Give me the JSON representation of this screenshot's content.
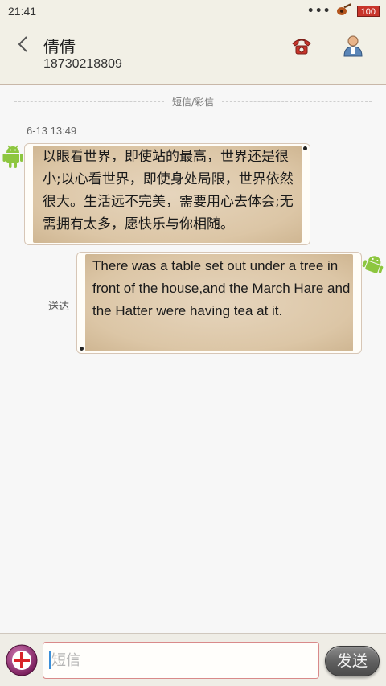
{
  "status_bar": {
    "time": "21:41",
    "dots": "•••",
    "battery": "100"
  },
  "header": {
    "back_icon": "chevron-left-icon",
    "contact_name": "倩倩",
    "contact_number": "18730218809",
    "call_icon": "phone-icon",
    "contact_icon": "person-icon"
  },
  "thread": {
    "divider_label": "短信/彩信",
    "timestamp": "6-13 13:49",
    "messages": [
      {
        "direction": "incoming",
        "text": "以眼看世界，即使站的最高，世界还是很小;以心看世界，即使身处局限，世界依然很大。生活远不完美，需要用心去体会;无需拥有太多，愿快乐与你相随。"
      },
      {
        "direction": "outgoing",
        "text": "There was a table set out under a tree in front of the house,and the March Hare and the Hatter were having tea at it.",
        "status": "送达"
      }
    ]
  },
  "composer": {
    "attach_icon": "add-icon",
    "placeholder": "短信",
    "value": "",
    "send_label": "发送"
  },
  "colors": {
    "accent_red": "#c8352b",
    "bubble_fill": "#dcc6a6",
    "header_bg": "#f2f0e6"
  }
}
